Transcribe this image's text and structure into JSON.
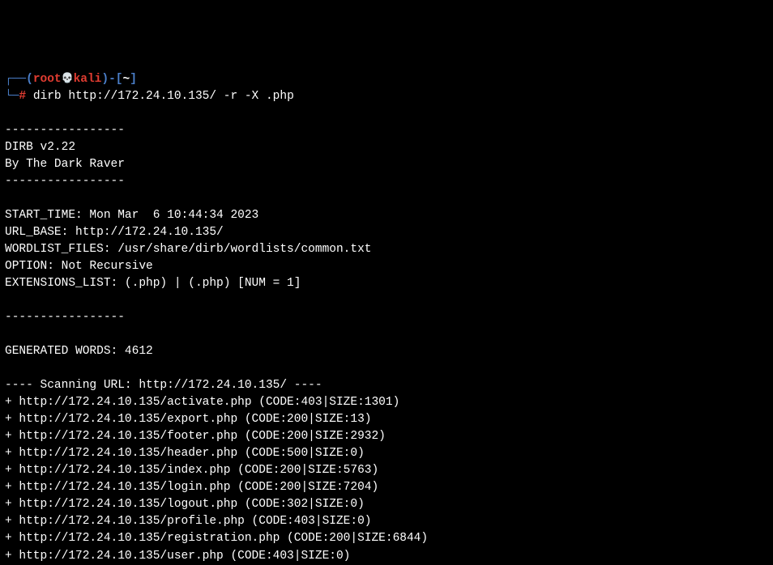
{
  "prompt": {
    "corner_l": "┌──(",
    "user": "root",
    "skull": "💀",
    "host": "kali",
    "corner_r": ")-[",
    "path": "~",
    "bracket_close": "]",
    "corner_bottom": "└─",
    "hash": "#",
    "command": "dirb http://172.24.10.135/ -r -X .php"
  },
  "banner": {
    "sep1": "-----------------",
    "line1": "DIRB v2.22    ",
    "line2": "By The Dark Raver",
    "sep2": "-----------------"
  },
  "info": {
    "start_time": "START_TIME: Mon Mar  6 10:44:34 2023",
    "url_base": "URL_BASE: http://172.24.10.135/",
    "wordlist": "WORDLIST_FILES: /usr/share/dirb/wordlists/common.txt",
    "option": "OPTION: Not Recursive",
    "extensions": "EXTENSIONS_LIST: (.php) | (.php) [NUM = 1]"
  },
  "sep3": "-----------------",
  "generated": "GENERATED WORDS: 4612",
  "scan_header": "---- Scanning URL: http://172.24.10.135/ ----",
  "results": [
    "+ http://172.24.10.135/activate.php (CODE:403|SIZE:1301)",
    "+ http://172.24.10.135/export.php (CODE:200|SIZE:13)",
    "+ http://172.24.10.135/footer.php (CODE:200|SIZE:2932)",
    "+ http://172.24.10.135/header.php (CODE:500|SIZE:0)",
    "+ http://172.24.10.135/index.php (CODE:200|SIZE:5763)",
    "+ http://172.24.10.135/login.php (CODE:200|SIZE:7204)",
    "+ http://172.24.10.135/logout.php (CODE:302|SIZE:0)",
    "+ http://172.24.10.135/profile.php (CODE:403|SIZE:0)",
    "+ http://172.24.10.135/registration.php (CODE:200|SIZE:6844)",
    "+ http://172.24.10.135/user.php (CODE:403|SIZE:0)"
  ]
}
